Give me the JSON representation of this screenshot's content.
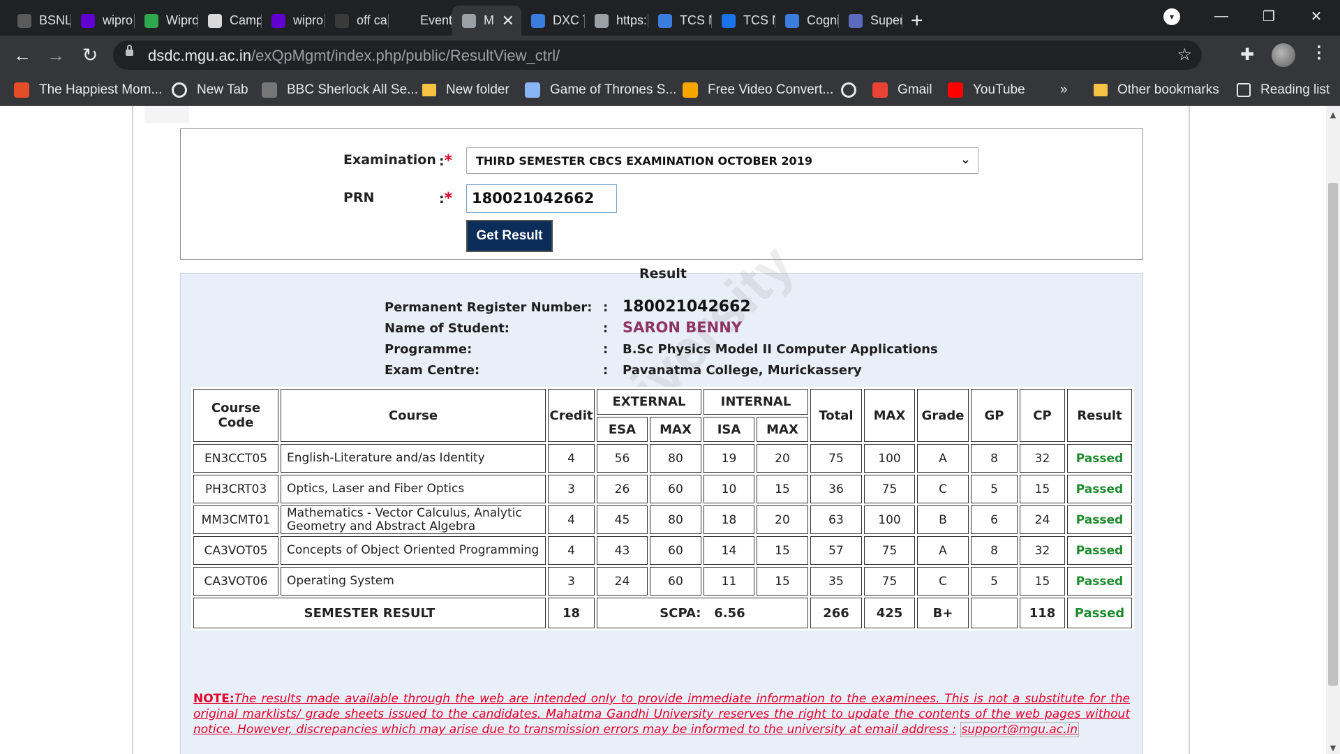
{
  "browser": {
    "tabs": [
      {
        "label": "BSNL",
        "icon": "bsnl-icon",
        "color": "#5a5a5a",
        "active": false
      },
      {
        "label": "wipro",
        "icon": "yahoo-icon",
        "color": "#6001d2",
        "active": false
      },
      {
        "label": "Wipro",
        "icon": "wipro-icon",
        "color": "#2fa84f",
        "active": false
      },
      {
        "label": "Camp",
        "icon": "campus-icon",
        "color": "#d9d9d9",
        "active": false
      },
      {
        "label": "wipro",
        "icon": "yahoo-icon",
        "color": "#6001d2",
        "active": false
      },
      {
        "label": "off ca",
        "icon": "websearch-icon",
        "color": "#3a3a3a",
        "active": false
      },
      {
        "label": "Event",
        "icon": "event-icon",
        "color": "#202124",
        "active": false
      },
      {
        "label": "M",
        "icon": "globe-icon",
        "color": "#9aa0a6",
        "active": true
      },
      {
        "label": "DXC T",
        "icon": "app-icon",
        "color": "#3b7ddd",
        "active": false
      },
      {
        "label": "https:",
        "icon": "globe-icon",
        "color": "#9aa0a6",
        "active": false
      },
      {
        "label": "TCS N",
        "icon": "app-icon",
        "color": "#3b7ddd",
        "active": false
      },
      {
        "label": "TCS N",
        "icon": "power-icon",
        "color": "#1a73e8",
        "active": false
      },
      {
        "label": "Cogni",
        "icon": "app-icon",
        "color": "#3b7ddd",
        "active": false
      },
      {
        "label": "Super",
        "icon": "super-icon",
        "color": "#5c6bc0",
        "active": false
      }
    ],
    "url_host": "dsdc.mgu.ac.in",
    "url_path": "/exQpMgmt/index.php/public/ResultView_ctrl/",
    "bookmarks": [
      {
        "label": "The Happiest Mom...",
        "icon": "colorful-app-icon",
        "color": "#e44d26"
      },
      {
        "label": "New Tab",
        "icon": "globe-icon",
        "color": "#e8eaed"
      },
      {
        "label": "BBC Sherlock All Se...",
        "icon": "sherlock-icon",
        "color": "#777777"
      },
      {
        "label": "New folder",
        "icon": "folder-icon",
        "color": "#f6c246"
      },
      {
        "label": "Game of Thrones S...",
        "icon": "image-icon",
        "color": "#8ab4f8"
      },
      {
        "label": "Free Video Convert...",
        "icon": "converter-icon",
        "color": "#f6a500"
      },
      {
        "label": "",
        "icon": "globe-icon",
        "color": "#e8eaed"
      },
      {
        "label": "Gmail",
        "icon": "gmail-icon",
        "color": "#ea4335"
      },
      {
        "label": "YouTube",
        "icon": "youtube-icon",
        "color": "#ff0000"
      }
    ],
    "overflow_label": "»",
    "other_bookmarks": "Other bookmarks",
    "reading_list": "Reading list"
  },
  "form": {
    "exam_label": "Examination",
    "prn_label": "PRN",
    "colon": ":",
    "required_mark": "*",
    "exam_value": "THIRD SEMESTER CBCS EXAMINATION OCTOBER 2019",
    "prn_value": "180021042662",
    "button_label": "Get Result"
  },
  "result": {
    "title": "Result",
    "watermark": "MG University",
    "fields": [
      {
        "label": "Permanent Register Number:",
        "value": "180021042662"
      },
      {
        "label": "Name of Student:",
        "value": "SARON BENNY"
      },
      {
        "label": "Programme:",
        "value": "B.Sc Physics Model II Computer Applications"
      },
      {
        "label": "Exam Centre:",
        "value": "Pavanatma College, Murickassery"
      }
    ],
    "separator": ":",
    "headers": {
      "course_code": "Course Code",
      "course": "Course",
      "credit": "Credit",
      "external": "EXTERNAL",
      "internal": "INTERNAL",
      "esa": "ESA",
      "max": "MAX",
      "isa": "ISA",
      "total": "Total",
      "grade": "Grade",
      "gp": "GP",
      "cp": "CP",
      "result": "Result"
    },
    "rows": [
      {
        "code": "EN3CCT05",
        "course": "English-Literature and/as Identity",
        "credit": "4",
        "esa": "56",
        "esa_max": "80",
        "isa": "19",
        "isa_max": "20",
        "total": "75",
        "max": "100",
        "grade": "A",
        "gp": "8",
        "cp": "32",
        "result": "Passed"
      },
      {
        "code": "PH3CRT03",
        "course": "Optics, Laser and Fiber Optics",
        "credit": "3",
        "esa": "26",
        "esa_max": "60",
        "isa": "10",
        "isa_max": "15",
        "total": "36",
        "max": "75",
        "grade": "C",
        "gp": "5",
        "cp": "15",
        "result": "Passed"
      },
      {
        "code": "MM3CMT01",
        "course": "Mathematics - Vector Calculus, Analytic Geometry and Abstract Algebra",
        "credit": "4",
        "esa": "45",
        "esa_max": "80",
        "isa": "18",
        "isa_max": "20",
        "total": "63",
        "max": "100",
        "grade": "B",
        "gp": "6",
        "cp": "24",
        "result": "Passed"
      },
      {
        "code": "CA3VOT05",
        "course": "Concepts of Object Oriented Programming",
        "credit": "4",
        "esa": "43",
        "esa_max": "60",
        "isa": "14",
        "isa_max": "15",
        "total": "57",
        "max": "75",
        "grade": "A",
        "gp": "8",
        "cp": "32",
        "result": "Passed"
      },
      {
        "code": "CA3VOT06",
        "course": "Operating System",
        "credit": "3",
        "esa": "24",
        "esa_max": "60",
        "isa": "11",
        "isa_max": "15",
        "total": "35",
        "max": "75",
        "grade": "C",
        "gp": "5",
        "cp": "15",
        "result": "Passed"
      }
    ],
    "semester": {
      "label": "SEMESTER RESULT",
      "credit": "18",
      "scpa_label": "SCPA:",
      "scpa": "6.56",
      "total": "266",
      "max": "425",
      "grade": "B+",
      "gp": "",
      "cp": "118",
      "result": "Passed"
    }
  },
  "note": {
    "label": "NOTE:",
    "text": "The results made available through the web are intended only to provide immediate information to the examinees. This is not a substitute for the original marklists/ grade sheets issued to the candidates. Mahatma Gandhi University reserves the right to update the contents of the web pages without notice. However, discrepancies which may arise due to transmission errors may be informed to the university at email address :",
    "email": "support@mgu.ac.in"
  },
  "colors": {
    "pass_green": "#1c8a2c",
    "name_color": "#8e3563",
    "note_red": "#e0002a",
    "button_navy": "#0b2d59",
    "result_panel_bg": "#e9eff8"
  }
}
